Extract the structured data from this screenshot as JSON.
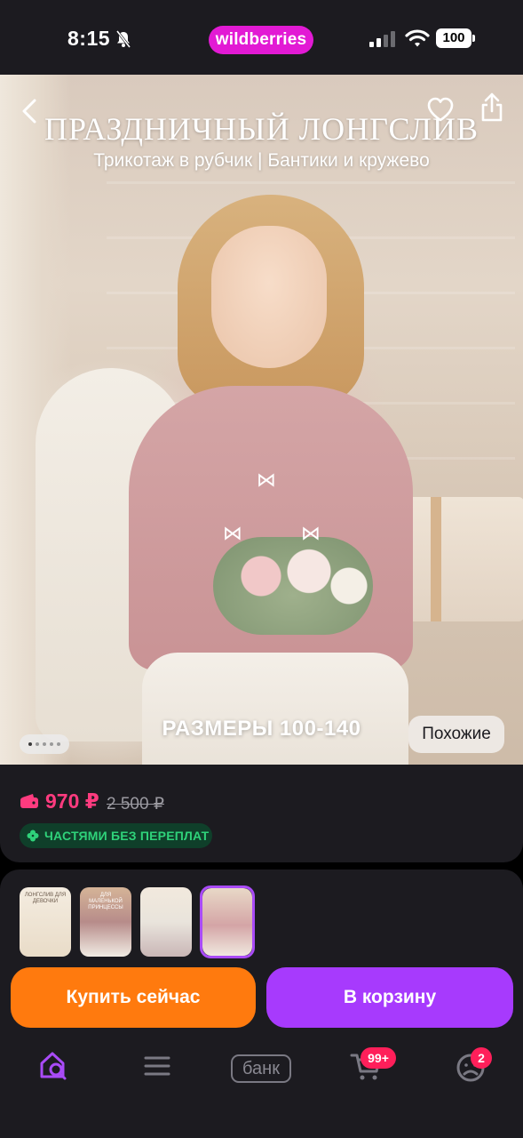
{
  "status_bar": {
    "time": "8:15",
    "app_logo": "wildberries",
    "battery": "100",
    "icons": [
      "bell-slash-icon",
      "signal-icon",
      "wifi-icon",
      "battery-icon"
    ]
  },
  "product": {
    "hero": {
      "title": "ПРАЗДНИЧНЫЙ ЛОНГСЛИВ",
      "subtitle": "Трикотаж в рубчик | Бантики и кружево",
      "sizes": "РАЗМЕРЫ 100-140",
      "similar_label": "Похожие",
      "current_image": 1,
      "image_count": 5
    },
    "price": {
      "current": "970 ₽",
      "old": "2 500 ₽",
      "installment": "ЧАСТЯМИ БЕЗ ПЕРЕПЛАТ"
    },
    "thumbnails": [
      {
        "caption": "ЛОНГСЛИВ ДЛЯ ДЕВОЧКИ",
        "selected": false
      },
      {
        "caption": "ДЛЯ МАЛЕНЬКОЙ ПРИНЦЕССЫ",
        "selected": false
      },
      {
        "caption": "",
        "selected": false
      },
      {
        "caption": "",
        "selected": true
      }
    ]
  },
  "actions": {
    "buy_now": "Купить сейчас",
    "add_to_cart": "В корзину"
  },
  "bottom_nav": {
    "items": [
      {
        "name": "home",
        "icon": "home-search-icon",
        "active": true
      },
      {
        "name": "catalog",
        "icon": "menu-icon",
        "active": false
      },
      {
        "name": "bank",
        "label": "банк",
        "active": false
      },
      {
        "name": "cart",
        "icon": "cart-icon",
        "badge": "99+",
        "active": false
      },
      {
        "name": "profile",
        "icon": "profile-icon",
        "badge": "2",
        "active": false
      }
    ]
  },
  "colors": {
    "brand": "#e21ad4",
    "price": "#ff3b7f",
    "buy_now": "#ff7a0e",
    "cart_button": "#a73afd",
    "installment_text": "#2fd27a",
    "badge": "#ff1f5a"
  }
}
